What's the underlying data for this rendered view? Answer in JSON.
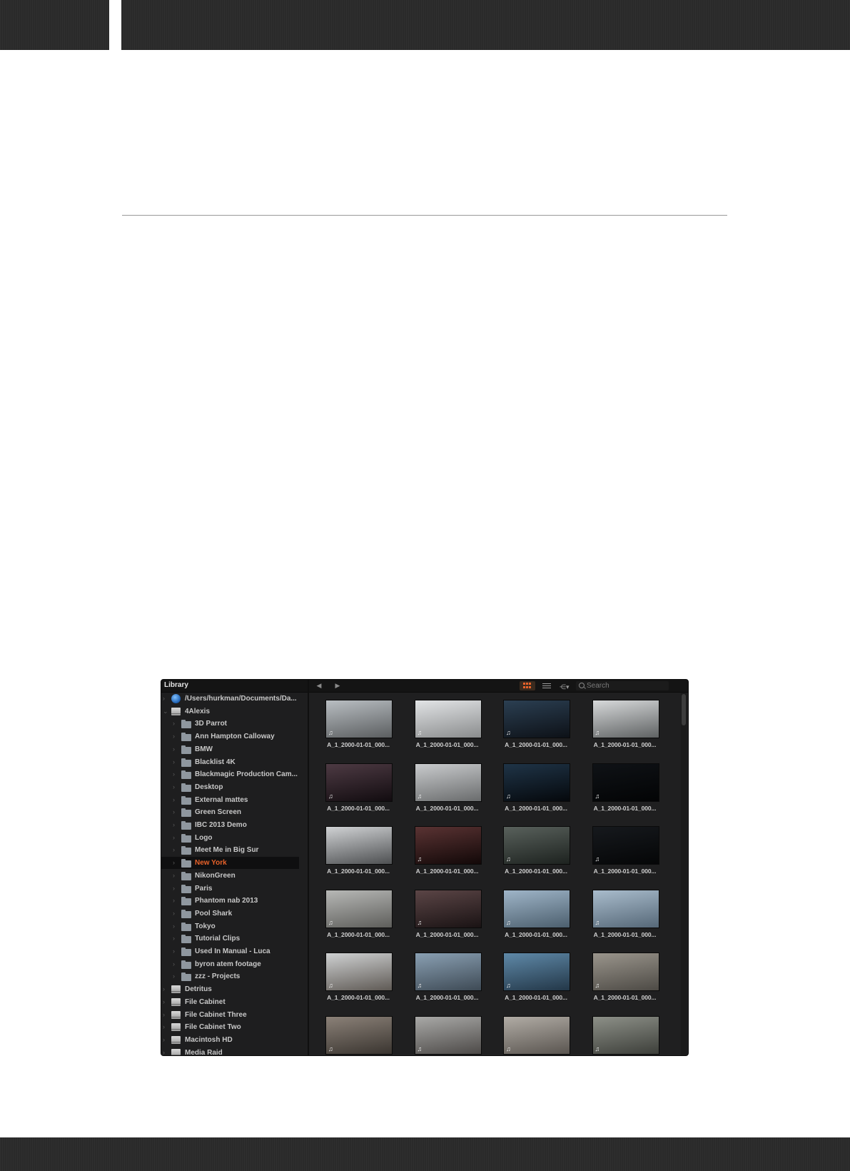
{
  "library_panel": {
    "title": "Library",
    "items": [
      {
        "label": "/Users/hurkman/Documents/Da...",
        "icon": "globe-icon",
        "level": 0,
        "selected": false
      },
      {
        "label": "4Alexis",
        "icon": "drive-icon",
        "level": 0,
        "selected": false
      },
      {
        "label": "3D Parrot",
        "icon": "folder-icon",
        "level": 1,
        "selected": false
      },
      {
        "label": "Ann Hampton Calloway",
        "icon": "folder-icon",
        "level": 1,
        "selected": false
      },
      {
        "label": "BMW",
        "icon": "folder-icon",
        "level": 1,
        "selected": false
      },
      {
        "label": "Blacklist 4K",
        "icon": "folder-icon",
        "level": 1,
        "selected": false
      },
      {
        "label": "Blackmagic Production Cam...",
        "icon": "folder-icon",
        "level": 1,
        "selected": false
      },
      {
        "label": "Desktop",
        "icon": "folder-icon",
        "level": 1,
        "selected": false
      },
      {
        "label": "External mattes",
        "icon": "folder-icon",
        "level": 1,
        "selected": false
      },
      {
        "label": "Green Screen",
        "icon": "folder-icon",
        "level": 1,
        "selected": false
      },
      {
        "label": "IBC 2013 Demo",
        "icon": "folder-icon",
        "level": 1,
        "selected": false
      },
      {
        "label": "Logo",
        "icon": "folder-icon",
        "level": 1,
        "selected": false
      },
      {
        "label": "Meet Me in Big Sur",
        "icon": "folder-icon",
        "level": 1,
        "selected": false
      },
      {
        "label": "New York",
        "icon": "folder-icon",
        "level": 1,
        "selected": true
      },
      {
        "label": "NikonGreen",
        "icon": "folder-icon",
        "level": 1,
        "selected": false
      },
      {
        "label": "Paris",
        "icon": "folder-icon",
        "level": 1,
        "selected": false
      },
      {
        "label": "Phantom nab 2013",
        "icon": "folder-icon",
        "level": 1,
        "selected": false
      },
      {
        "label": "Pool Shark",
        "icon": "folder-icon",
        "level": 1,
        "selected": false
      },
      {
        "label": "Tokyo",
        "icon": "folder-icon",
        "level": 1,
        "selected": false
      },
      {
        "label": "Tutorial Clips",
        "icon": "folder-icon",
        "level": 1,
        "selected": false
      },
      {
        "label": "Used In Manual - Luca",
        "icon": "folder-icon",
        "level": 1,
        "selected": false
      },
      {
        "label": "byron atem footage",
        "icon": "folder-icon",
        "level": 1,
        "selected": false
      },
      {
        "label": "zzz - Projects",
        "icon": "folder-icon",
        "level": 1,
        "selected": false
      },
      {
        "label": "Detritus",
        "icon": "drive-icon",
        "level": 0,
        "selected": false
      },
      {
        "label": "File Cabinet",
        "icon": "drive-icon",
        "level": 0,
        "selected": false
      },
      {
        "label": "File Cabinet Three",
        "icon": "drive-icon",
        "level": 0,
        "selected": false
      },
      {
        "label": "File Cabinet Two",
        "icon": "drive-icon",
        "level": 0,
        "selected": false
      },
      {
        "label": "Macintosh HD",
        "icon": "drive-icon",
        "level": 0,
        "selected": false
      },
      {
        "label": "Media Raid",
        "icon": "drive-icon",
        "level": 0,
        "selected": false
      }
    ]
  },
  "browser": {
    "nav_back": "◀",
    "nav_forward": "▶",
    "view_mode": "thumbnail-grid",
    "search_placeholder": "Search",
    "accent_color": "#e8622a",
    "clip_name": "A_1_2000-01-01_000...",
    "clips": [
      {
        "name": "A_1_2000-01-01_000...",
        "tone": [
          "#b9bec2",
          "#5b5e60"
        ],
        "audio": true
      },
      {
        "name": "A_1_2000-01-01_000...",
        "tone": [
          "#e2e4e6",
          "#8a8c8d"
        ],
        "audio": true
      },
      {
        "name": "A_1_2000-01-01_000...",
        "tone": [
          "#2b3f52",
          "#0d1117"
        ],
        "audio": true
      },
      {
        "name": "A_1_2000-01-01_000...",
        "tone": [
          "#d7d9da",
          "#5f6263"
        ],
        "audio": true
      },
      {
        "name": "A_1_2000-01-01_000...",
        "tone": [
          "#4d3a43",
          "#120c10"
        ],
        "audio": true
      },
      {
        "name": "A_1_2000-01-01_000...",
        "tone": [
          "#c9cbcd",
          "#6a6c6d"
        ],
        "audio": true
      },
      {
        "name": "A_1_2000-01-01_000...",
        "tone": [
          "#1f3447",
          "#05080c"
        ],
        "audio": true
      },
      {
        "name": "A_1_2000-01-01_000...",
        "tone": [
          "#0f1216",
          "#030405"
        ],
        "audio": true
      },
      {
        "name": "A_1_2000-01-01_000...",
        "tone": [
          "#d0d2d4",
          "#4e5052"
        ],
        "audio": false
      },
      {
        "name": "A_1_2000-01-01_000...",
        "tone": [
          "#5a3333",
          "#120808"
        ],
        "audio": true
      },
      {
        "name": "A_1_2000-01-01_000...",
        "tone": [
          "#59615c",
          "#1d221f"
        ],
        "audio": true
      },
      {
        "name": "A_1_2000-01-01_000...",
        "tone": [
          "#16191d",
          "#050607"
        ],
        "audio": true
      },
      {
        "name": "A_1_2000-01-01_000...",
        "tone": [
          "#b7b8b6",
          "#5e5e5b"
        ],
        "audio": true
      },
      {
        "name": "A_1_2000-01-01_000...",
        "tone": [
          "#5b4546",
          "#1a1314"
        ],
        "audio": true
      },
      {
        "name": "A_1_2000-01-01_000...",
        "tone": [
          "#9fb5c8",
          "#4c5f6e"
        ],
        "audio": true
      },
      {
        "name": "A_1_2000-01-01_000...",
        "tone": [
          "#a9bccc",
          "#566878"
        ],
        "audio": true
      },
      {
        "name": "A_1_2000-01-01_000...",
        "tone": [
          "#cfd1d2",
          "#5f5a55"
        ],
        "audio": true
      },
      {
        "name": "A_1_2000-01-01_000...",
        "tone": [
          "#8aa0b3",
          "#3e4a55"
        ],
        "audio": true
      },
      {
        "name": "A_1_2000-01-01_000...",
        "tone": [
          "#5f89a8",
          "#233748"
        ],
        "audio": true
      },
      {
        "name": "A_1_2000-01-01_000...",
        "tone": [
          "#9a958c",
          "#4d4a45"
        ],
        "audio": true
      },
      {
        "name": "",
        "tone": [
          "#8b8178",
          "#3a3530"
        ],
        "audio": true
      },
      {
        "name": "",
        "tone": [
          "#a9a9a7",
          "#4d4a48"
        ],
        "audio": true
      },
      {
        "name": "",
        "tone": [
          "#b1aca5",
          "#5a5550"
        ],
        "audio": true
      },
      {
        "name": "",
        "tone": [
          "#8d9088",
          "#3d3f3a"
        ],
        "audio": true
      }
    ]
  }
}
